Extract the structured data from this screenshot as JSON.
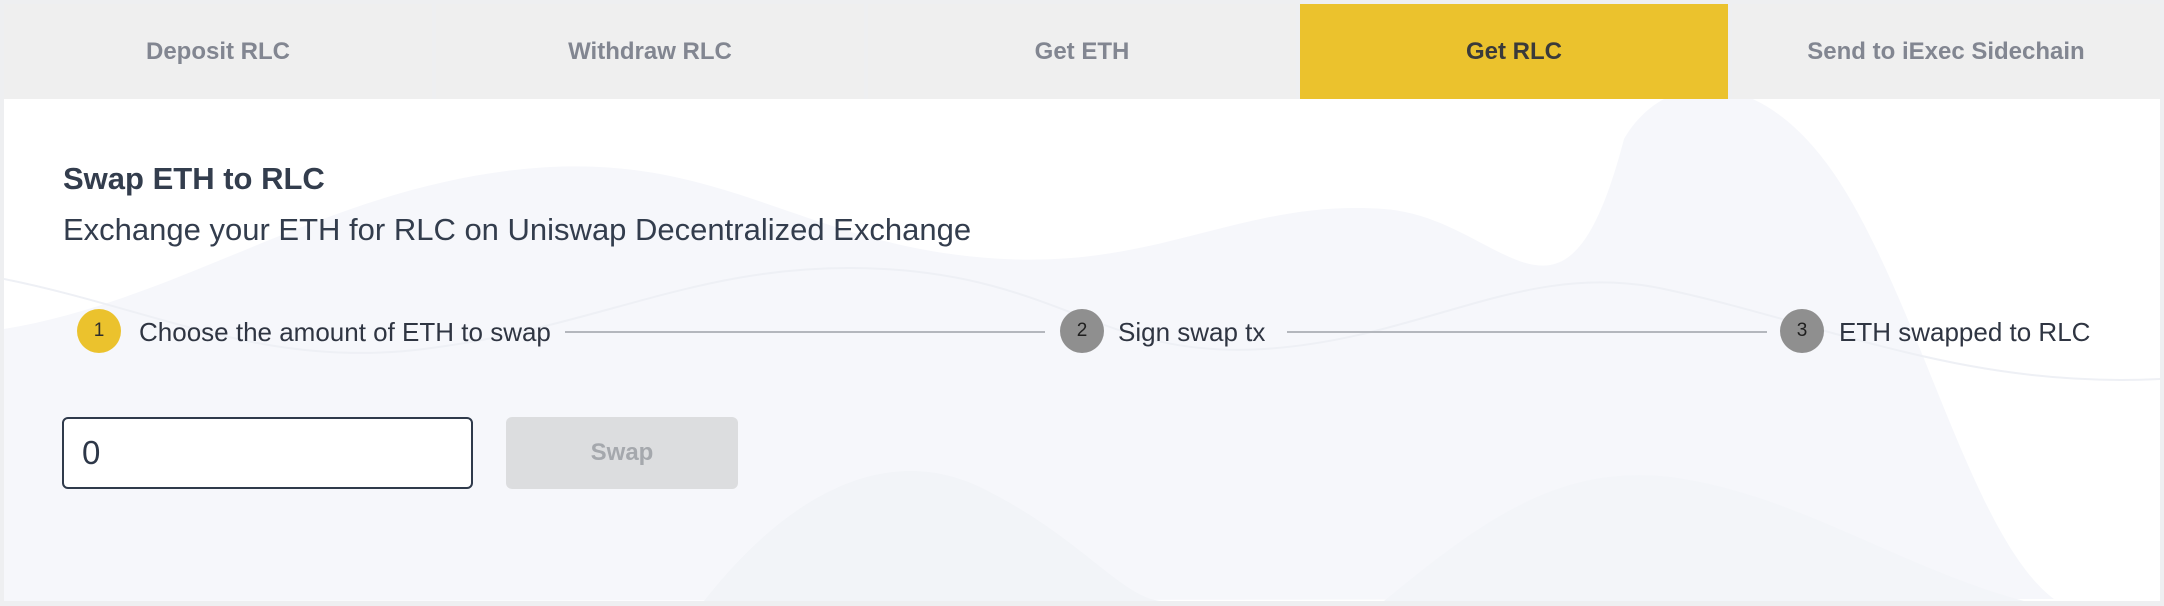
{
  "tabs": [
    {
      "label": "Deposit RLC",
      "active": false
    },
    {
      "label": "Withdraw RLC",
      "active": false
    },
    {
      "label": "Get ETH",
      "active": false
    },
    {
      "label": "Get RLC",
      "active": true
    },
    {
      "label": "Send to iExec Sidechain",
      "active": false
    }
  ],
  "panel": {
    "title": "Swap ETH to RLC",
    "subtitle": "Exchange your ETH for RLC on Uniswap Decentralized Exchange"
  },
  "steps": [
    {
      "number": "1",
      "label": "Choose the amount of ETH to swap",
      "state": "active"
    },
    {
      "number": "2",
      "label": "Sign swap tx",
      "state": "pending"
    },
    {
      "number": "3",
      "label": "ETH swapped to RLC",
      "state": "pending"
    }
  ],
  "form": {
    "amount_value": "0",
    "swap_label": "Swap"
  },
  "colors": {
    "accent": "#ebc22d",
    "pending_step": "#8f8f8f",
    "text": "#333d4d"
  }
}
